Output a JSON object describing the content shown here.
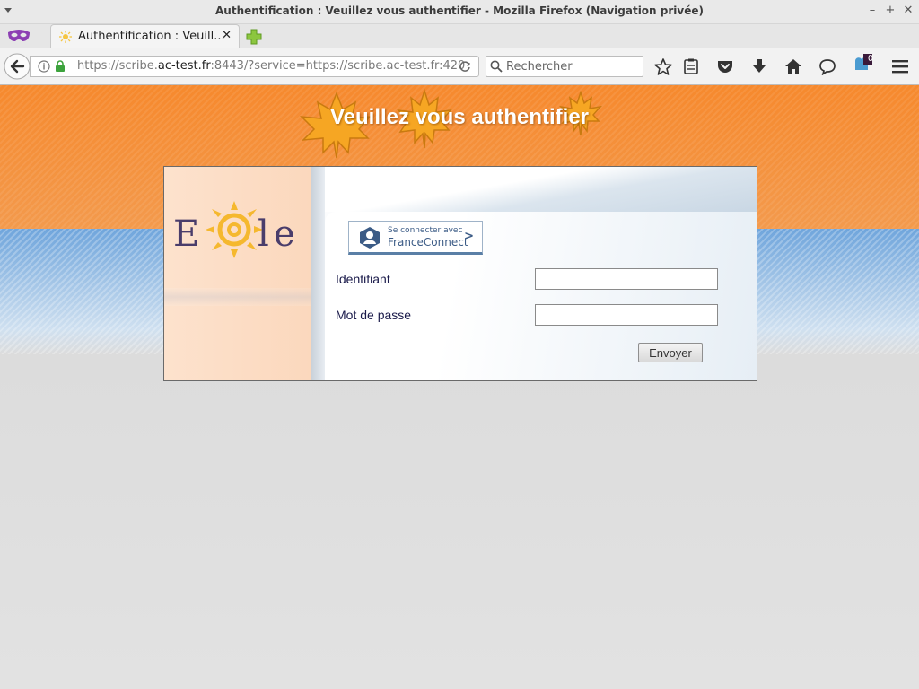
{
  "window": {
    "title": "Authentification : Veuillez vous authentifier - Mozilla Firefox (Navigation privée)"
  },
  "tab": {
    "label": "Authentification : Veuill..."
  },
  "address_bar": {
    "url_scheme": "https://",
    "url_sub": "scribe.",
    "url_host": "ac-test.fr",
    "url_rest": ":8443/?service=https://scribe.ac-test.fr:420"
  },
  "search": {
    "placeholder": "Rechercher"
  },
  "toolbar": {
    "notification_count": "0"
  },
  "page": {
    "heading": "Veuillez vous authentifier",
    "logo_text": "EOLE",
    "franceconnect_line1": "Se connecter avec",
    "franceconnect_line2": "FranceConnect",
    "franceconnect_arrow": ">",
    "username_label": "Identifiant",
    "password_label": "Mot de passe",
    "username_value": "",
    "password_value": "",
    "submit_label": "Envoyer"
  },
  "colors": {
    "header_orange": "#f6892d",
    "band_blue": "#6fa5dc",
    "label_color": "#1a1a4a",
    "franceconnect_blue": "#3b5b86"
  }
}
